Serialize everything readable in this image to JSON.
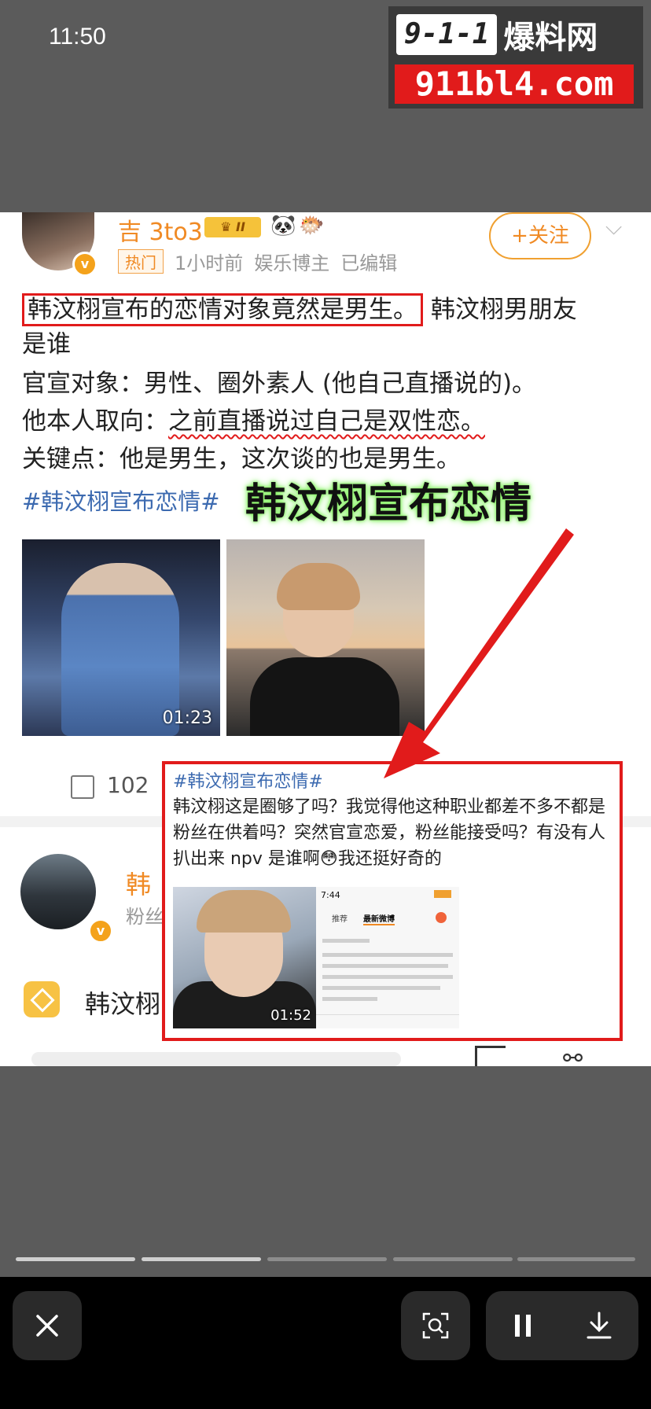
{
  "status": {
    "time": "11:50"
  },
  "watermark": {
    "logo": "9-1-1",
    "site_name": "爆料网",
    "url": "911bl4.com"
  },
  "post1": {
    "author": "吉 3to3",
    "badge_level": "II",
    "tag": "热门",
    "time_ago": "1小时前",
    "role": "娱乐博主",
    "edited": "已编辑",
    "follow_label": "+关注",
    "line1_boxed": "韩汶栩宣布的恋情对象竟然是男生。",
    "line1_rest": "韩汶栩男朋友",
    "line2": "是谁",
    "line3": "官宣对象：男性、圈外素人 (他自己直播说的)。",
    "line4_prefix": "他本人取向：",
    "line4_underlined": "之前直播说过自己是双性恋。",
    "line5": "关键点：他是男生，这次谈的也是男生。",
    "hashtag": "#韩汶栩宣布恋情#",
    "video1_duration": "01:23",
    "repost_count": "102"
  },
  "overlay_caption": "韩汶栩宣布恋情",
  "post2": {
    "author": "韩",
    "meta": "粉丝",
    "topic": "韩汶栩"
  },
  "inset": {
    "hashtag": "#韩汶栩宣布恋情#",
    "text": "韩汶栩这是圈够了吗？我觉得他这种职业都差不多不都是粉丝在供着吗？突然官宣恋爱，粉丝能接受吗？有没有人扒出来 npv 是谁啊😳我还挺好奇的",
    "video_duration": "01:52",
    "shot_time": "7:44",
    "shot_tab1": "推荐",
    "shot_tab2": "最新微博"
  },
  "colors": {
    "accent": "#f08a24",
    "highlight": "#e11b1b",
    "link": "#3c6ab0"
  },
  "icons": [
    "close-icon",
    "screenshot-search-icon",
    "pause-icon",
    "download-icon"
  ]
}
